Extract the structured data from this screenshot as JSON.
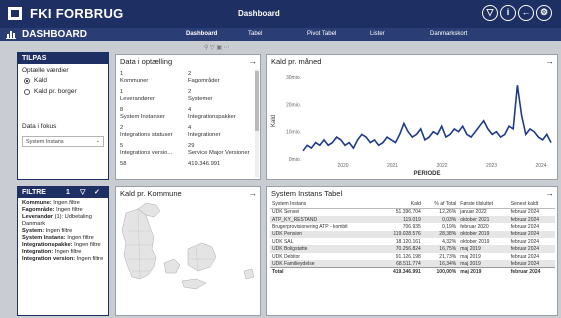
{
  "header": {
    "app_title": "FKI FORBRUG",
    "page_name": "Dashboard",
    "buttons": [
      "bookmark-icon",
      "info-icon",
      "back-icon",
      "settings-icon"
    ]
  },
  "nav": {
    "title": "DASHBOARD",
    "tabs": [
      "Dashboard",
      "Tabel",
      "Pivot Tabel",
      "Lister",
      "Danmarkskort"
    ]
  },
  "tilpas": {
    "title": "TILPAS",
    "values_label": "Optælle værdier",
    "options": [
      "Kald",
      "Kald pr. borger"
    ],
    "selected": "Kald",
    "focus_label": "Data i fokus",
    "focus_value": "System Instans"
  },
  "counting": {
    "title": "Data i optælling",
    "cells": [
      [
        "1",
        "Kommuner"
      ],
      [
        "2",
        "Fagområder"
      ],
      [
        "1",
        "Leverandører"
      ],
      [
        "2",
        "Systemer"
      ],
      [
        "8",
        "System Instanser"
      ],
      [
        "4",
        "Integrationspakker"
      ],
      [
        "2",
        "Integrations statuser"
      ],
      [
        "4",
        "Integrationer"
      ],
      [
        "5",
        "Integrations versio..."
      ],
      [
        "29",
        "Service Major Versioner"
      ],
      [
        "58",
        ""
      ],
      [
        "419.346.991",
        ""
      ]
    ]
  },
  "kald_maaned": {
    "title": "Kald pr. måned",
    "ylabel": "Kald",
    "xlabel": "PERIODE",
    "y_ticks": [
      "30mio.",
      "20mio.",
      "10mio.",
      "0mio."
    ],
    "x_ticks": [
      "2020",
      "2021",
      "2022",
      "2023",
      "2024"
    ]
  },
  "filters": {
    "title": "FILTRE",
    "count": "1",
    "items": [
      {
        "label": "Kommune:",
        "value": " Ingen filtre"
      },
      {
        "label": "Fagområde:",
        "value": " Ingen filtre"
      },
      {
        "label": "Leverandør",
        "value": " (1): Udbetaling Danmark"
      },
      {
        "label": "System:",
        "value": " Ingen filtre"
      },
      {
        "label": "System Instans:",
        "value": " Ingen filtre"
      },
      {
        "label": "Integrationspakke:",
        "value": " Ingen filtre"
      },
      {
        "label": "Integration:",
        "value": " Ingen filtre"
      },
      {
        "label": "Integration version:",
        "value": " Ingen filtre"
      }
    ]
  },
  "kommune_map": {
    "title": "Kald pr. Kommune"
  },
  "system_table": {
    "title": "System Instans Tabel",
    "columns": [
      "System Instans",
      "Kald",
      "% af Total",
      "Første tilsluttet",
      "Senest kaldt"
    ],
    "rows": [
      [
        "UDK Sensei",
        "51.396.704",
        "12,26%",
        "januar 2022",
        "februar 2024"
      ],
      [
        "ATP_KY_RESTAND",
        "119.019",
        "0,03%",
        "oktober 2021",
        "februar 2024"
      ],
      [
        "Brugerprovisionering ATP - kombit",
        "706.935",
        "0,19%",
        "februar 2020",
        "februar 2024"
      ],
      [
        "UDK Pension",
        "119.028.576",
        "28,38%",
        "oktober 2019",
        "februar 2024"
      ],
      [
        "UDK SAL",
        "18.120.161",
        "4,32%",
        "oktober 2019",
        "februar 2024"
      ],
      [
        "UDK Boligstøtte",
        "70.256.824",
        "16,75%",
        "maj 2019",
        "februar 2024"
      ],
      [
        "UDK Debitor",
        "91.126.198",
        "21,73%",
        "maj 2019",
        "februar 2024"
      ],
      [
        "UDK Familieydelse",
        "68.511.774",
        "16,34%",
        "maj 2019",
        "februar 2024"
      ]
    ],
    "total": [
      "Total",
      "419.346.991",
      "100,00%",
      "maj 2019",
      "februar 2024"
    ]
  },
  "chart_data": {
    "type": "line",
    "title": "Kald pr. måned",
    "xlabel": "PERIODE",
    "ylabel": "Kald",
    "ylim": [
      0,
      30
    ],
    "x_range": [
      "2019-05",
      "2024-02"
    ],
    "unit": "mio.",
    "series": [
      {
        "values": [
          3,
          5,
          4,
          6,
          5,
          7,
          5,
          6,
          8,
          7,
          5,
          6,
          4,
          7,
          9,
          8,
          6,
          7,
          5,
          6,
          8,
          7,
          6,
          9,
          13,
          10,
          8,
          9,
          11,
          7,
          8,
          10,
          9,
          12,
          8,
          9,
          11,
          10,
          12,
          9,
          8,
          10,
          12,
          14,
          11,
          9,
          10,
          8,
          9,
          12,
          11,
          27,
          16,
          9,
          11,
          10,
          8,
          7,
          9,
          6
        ]
      }
    ],
    "color": "#1f3a8a",
    "grid": false
  }
}
